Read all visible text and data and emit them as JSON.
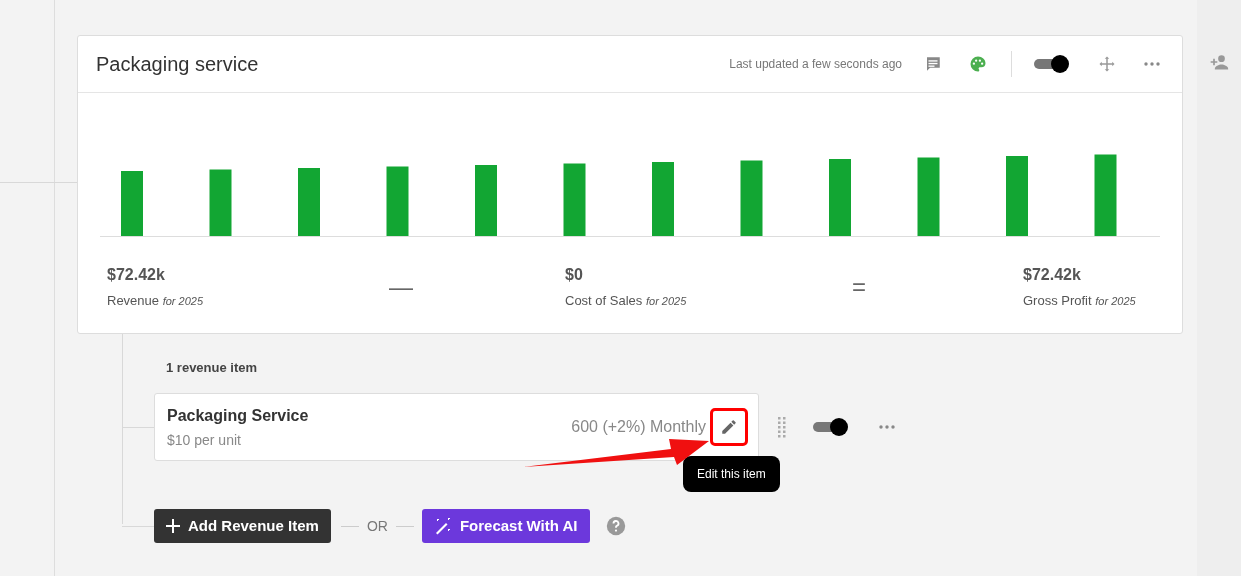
{
  "card": {
    "title": "Packaging service",
    "last_updated": "Last updated a few seconds ago",
    "toggle": {
      "on": true
    },
    "totals": [
      {
        "kind": "value",
        "amount": "$72.42k",
        "label": "Revenue",
        "period": "for 2025"
      },
      {
        "kind": "operator",
        "symbol": "—"
      },
      {
        "kind": "value",
        "amount": "$0",
        "label": "Cost of Sales",
        "period": "for 2025"
      },
      {
        "kind": "operator",
        "symbol": "="
      },
      {
        "kind": "value",
        "amount": "$72.42k",
        "label": "Gross Profit",
        "period": "for 2025"
      }
    ]
  },
  "items_heading": "1 revenue item",
  "items": [
    {
      "name": "Packaging Service",
      "price": "$10 per unit",
      "forecast": "600 (+2%) Monthly",
      "on": true,
      "tooltip": "Edit this item"
    }
  ],
  "actions": {
    "add": "Add Revenue Item",
    "or": "OR",
    "ai": "Forecast With AI"
  }
}
